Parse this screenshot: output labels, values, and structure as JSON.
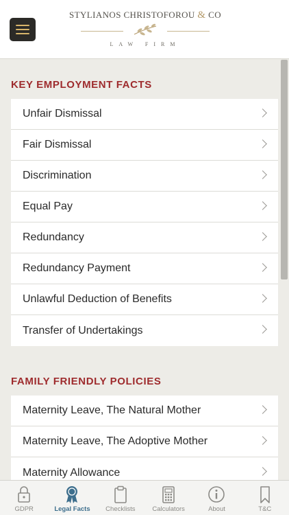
{
  "header": {
    "logo_main": "STYLIANOS CHRISTOFOROU",
    "logo_amp": "&",
    "logo_co": "CO",
    "logo_sub": "LAW FIRM"
  },
  "sections": [
    {
      "title": "KEY EMPLOYMENT FACTS",
      "items": [
        "Unfair Dismissal",
        "Fair Dismissal",
        "Discrimination",
        "Equal Pay",
        "Redundancy",
        "Redundancy Payment",
        "Unlawful Deduction of Benefits",
        "Transfer of Undertakings"
      ]
    },
    {
      "title": "FAMILY FRIENDLY POLICIES",
      "items": [
        "Maternity Leave, The Natural Mother",
        "Maternity Leave, The Adoptive Mother",
        "Maternity Allowance"
      ]
    }
  ],
  "tabs": [
    {
      "label": "GDPR",
      "icon": "lock-icon",
      "active": false
    },
    {
      "label": "Legal Facts",
      "icon": "award-ribbon-icon",
      "active": true
    },
    {
      "label": "Checklists",
      "icon": "clipboard-icon",
      "active": false
    },
    {
      "label": "Calculators",
      "icon": "calculator-icon",
      "active": false
    },
    {
      "label": "About",
      "icon": "info-icon",
      "active": false
    },
    {
      "label": "T&C",
      "icon": "bookmark-icon",
      "active": false
    }
  ],
  "colors": {
    "accent": "#9e2b2d",
    "active_tab": "#3e6f8d",
    "background": "#edece7"
  }
}
